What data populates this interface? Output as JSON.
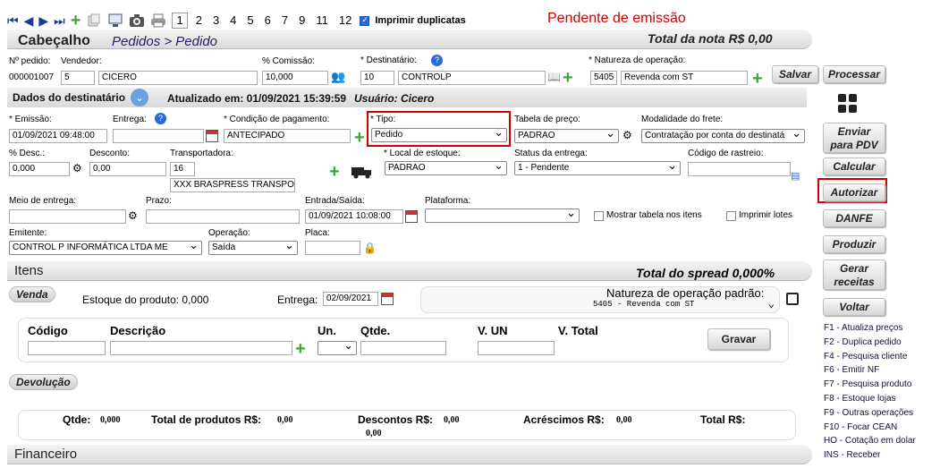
{
  "toolbar": {
    "pages": [
      "1",
      "2",
      "3",
      "4",
      "5",
      "6",
      "7",
      "9",
      "11",
      "12"
    ],
    "print_duplicates_label": "Imprimir duplicatas",
    "status": "Pendente de emissão"
  },
  "header": {
    "title": "Cabeçalho",
    "breadcrumb": "Pedidos > Pedido",
    "total_note": "Total da nota R$ 0,00"
  },
  "order": {
    "num_label": "Nº pedido:",
    "num_value": "000001007",
    "seller_label": "Vendedor:",
    "seller_code": "5",
    "seller_name": "CICERO",
    "commission_label": "% Comissão:",
    "commission_value": "10,000",
    "recipient_label": "* Destinatário:",
    "recipient_code": "10",
    "recipient_name": "CONTROLP",
    "nature_label": "* Natureza de operação:",
    "nature_code": "5405",
    "nature_name": "Revenda com ST"
  },
  "recipient_bar": {
    "title": "Dados do destinatário",
    "updated": "Atualizado em: 01/09/2021 15:39:59",
    "user": "Usuário: Cicero"
  },
  "form": {
    "emission_label": "* Emissão:",
    "emission_value": "01/09/2021 09:48:00",
    "delivery_label": "Entrega:",
    "delivery_value": "",
    "payment_label": "* Condição de pagamento:",
    "payment_value": "ANTECIPADO",
    "type_label": "* Tipo:",
    "type_value": "Pedido",
    "price_table_label": "Tabela de preço:",
    "price_table_value": "PADRAO",
    "freight_label": "Modalidade do frete:",
    "freight_value": "Contratação por conta do destinatá",
    "discount_pct_label": "% Desc.:",
    "discount_pct_value": "0,000",
    "discount_label": "Desconto:",
    "discount_value": "0,00",
    "carrier_label": "Transportadora:",
    "carrier_code": "16",
    "carrier_name": "XXX BRASPRESS TRANSPO",
    "stock_label": "* Local de estoque:",
    "stock_value": "PADRAO",
    "delivery_status_label": "Status da entrega:",
    "delivery_status_value": "1 - Pendente",
    "tracking_label": "Código de rastreio:",
    "tracking_value": "",
    "delivery_method_label": "Meio de entrega:",
    "delivery_method_value": "",
    "term_label": "Prazo:",
    "term_value": "",
    "in_out_label": "Entrada/Saída:",
    "in_out_value": "01/09/2021 10:08:00",
    "platform_label": "Plataforma:",
    "platform_value": "",
    "show_table_label": "Mostrar tabela nos itens",
    "print_lots_label": "Imprimir lotes",
    "issuer_label": "Emitente:",
    "issuer_value": "CONTROL P INFORMÁTICA LTDA ME",
    "operation_label": "Operação:",
    "operation_value": "Saída",
    "plate_label": "Placa:",
    "plate_value": ""
  },
  "items": {
    "title": "Itens",
    "spread": "Total do spread 0,000%",
    "sale_tab": "Venda",
    "stock_text": "Estoque do produto: 0,000",
    "delivery_label": "Entrega:",
    "delivery_value": "02/09/2021",
    "default_nature_label": "Natureza de operação padrão:",
    "default_nature_value": "5405 - Revenda com ST",
    "col_code": "Código",
    "col_desc": "Descrição",
    "col_unit": "Un.",
    "col_qty": "Qtde.",
    "col_vun": "V. UN",
    "col_total": "V. Total",
    "save_button": "Gravar",
    "return_tab": "Devolução"
  },
  "totals": {
    "qty_label": "Qtde:",
    "qty_value": "0,000",
    "products_label": "Total de produtos R$:",
    "products_value": "0,00",
    "discounts_label": "Descontos R$:",
    "discounts_value": "0,00",
    "additions_label": "Acréscimos R$:",
    "additions_value": "0,00",
    "total_label": "Total R$:",
    "total_value": "0,00"
  },
  "financial": {
    "title": "Financeiro"
  },
  "side": {
    "save": "Salvar",
    "process": "Processar",
    "send_pdv_1": "Enviar",
    "send_pdv_2": "para PDV",
    "calculate": "Calcular",
    "authorize": "Autorizar",
    "danfe": "DANFE",
    "produce": "Produzir",
    "recipes_1": "Gerar",
    "recipes_2": "receitas",
    "back": "Voltar"
  },
  "shortcuts": [
    "F1 - Atualiza preços",
    "F2 - Duplica pedido",
    "F4 - Pesquisa cliente",
    "F6 - Emitir NF",
    "F7 - Pesquisa produto",
    "F8 - Estoque lojas",
    "F9 - Outras operações",
    "F10 - Focar CEAN",
    "HO - Cotação em dolar",
    "INS - Receber"
  ]
}
